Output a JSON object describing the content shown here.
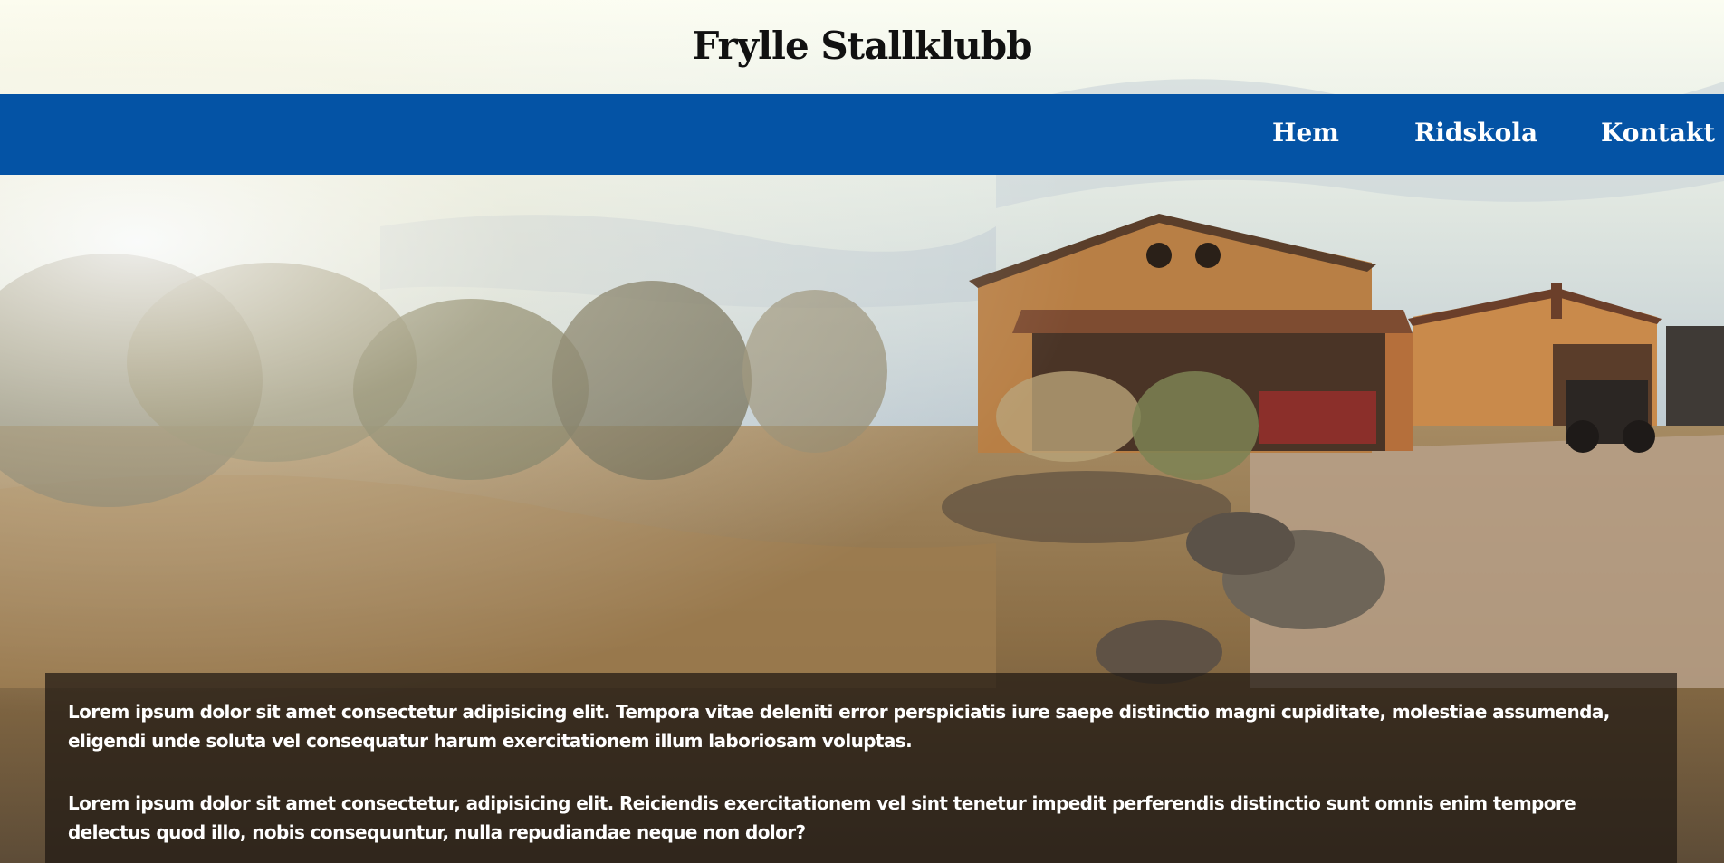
{
  "header": {
    "title": "Frylle Stallklubb"
  },
  "nav": {
    "items": [
      {
        "label": "Hem"
      },
      {
        "label": "Ridskola"
      },
      {
        "label": "Kontakt"
      }
    ],
    "background_color": "#0453a5"
  },
  "content": {
    "paragraphs": [
      "Lorem ipsum dolor sit amet consectetur adipisicing elit. Tempora vitae deleniti error perspiciatis iure saepe distinctio magni cupiditate, molestiae assumenda, eligendi unde soluta vel consequatur harum exercitationem illum laboriosam voluptas.",
      "Lorem ipsum dolor sit amet consectetur, adipisicing elit. Reiciendis exercitationem vel sint tenetur impedit perferendis distinctio sunt omnis enim tempore delectus quod illo, nobis consequuntur, nulla repudiandae neque non dolor?"
    ]
  },
  "hero": {
    "image_subject": "farm-barn-landscape-photo"
  }
}
